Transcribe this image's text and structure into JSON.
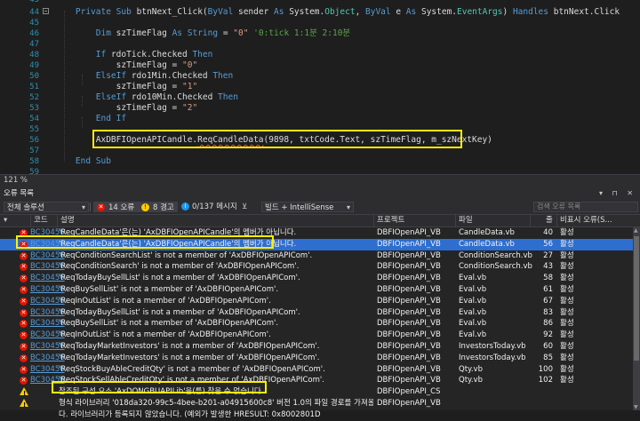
{
  "editor": {
    "line_numbers": [
      "44",
      "45",
      "46",
      "47",
      "48",
      "49",
      "50",
      "51",
      "52",
      "53",
      "54",
      "55",
      "56",
      "57",
      "58",
      "59"
    ],
    "lines": [
      {
        "num": "44",
        "code": "    Private Sub btnNext_Click(ByVal sender As System.Object, ByVal e As System.EventArgs) Handles btnNext.Click"
      },
      {
        "num": "45",
        "code": ""
      },
      {
        "num": "46",
        "code": "        Dim szTimeFlag As String = \"0\" '0:tick 1:1분 2:10분"
      },
      {
        "num": "47",
        "code": ""
      },
      {
        "num": "48",
        "code": "        If rdoTick.Checked Then"
      },
      {
        "num": "49",
        "code": "            szTimeFlag = \"0\""
      },
      {
        "num": "50",
        "code": "        ElseIf rdo1Min.Checked Then"
      },
      {
        "num": "51",
        "code": "            szTimeFlag = \"1\""
      },
      {
        "num": "52",
        "code": "        ElseIf rdo10Min.Checked Then"
      },
      {
        "num": "53",
        "code": "            szTimeFlag = \"2\""
      },
      {
        "num": "54",
        "code": "        End If"
      },
      {
        "num": "55",
        "code": ""
      },
      {
        "num": "56",
        "code": "        AxDBFIOpenAPICandle.ReqCandleData(9898, txtCode.Text, szTimeFlag, m_szNextKey)"
      },
      {
        "num": "57",
        "code": ""
      },
      {
        "num": "58",
        "code": "    End Sub"
      },
      {
        "num": "59",
        "code": ""
      }
    ],
    "zoom": "121 %"
  },
  "error_panel": {
    "title": "오류 목록",
    "scope_dropdown": "전체 솔루션",
    "errors_toggle": "14 오류",
    "warnings_toggle": "8 경고",
    "messages_toggle": "0/137 메시지",
    "build_dropdown": "빌드 + IntelliSense",
    "search_placeholder": "검색 오류 목록",
    "columns": {
      "code": "코드",
      "description": "설명",
      "project": "프로젝트",
      "file": "파일",
      "line": "줄",
      "state": "비표시 오류(S..."
    },
    "rows": [
      {
        "type": "error",
        "code": "BC30456",
        "desc": "'ReqCandleData'은(는) 'AxDBFIOpenAPICandle'의 멤버가 아닙니다.",
        "project": "DBFIOpenAPI_VB",
        "file": "CandleData.vb",
        "line": "40",
        "state": "활성"
      },
      {
        "type": "error",
        "code": "BC30456",
        "desc": "'ReqCandleData'은(는) 'AxDBFIOpenAPICandle'의 멤버가 아닙니다.",
        "project": "DBFIOpenAPI_VB",
        "file": "CandleData.vb",
        "line": "56",
        "state": "활성"
      },
      {
        "type": "error",
        "code": "BC30456",
        "desc": "'ReqConditionSearchList' is not a member of 'AxDBFIOpenAPICom'.",
        "project": "DBFIOpenAPI_VB",
        "file": "ConditionSearch.vb",
        "line": "27",
        "state": "활성"
      },
      {
        "type": "error",
        "code": "BC30456",
        "desc": "'ReqConditionSearch' is not a member of 'AxDBFIOpenAPICom'.",
        "project": "DBFIOpenAPI_VB",
        "file": "ConditionSearch.vb",
        "line": "43",
        "state": "활성"
      },
      {
        "type": "error",
        "code": "BC30456",
        "desc": "'ReqTodayBuySellList' is not a member of 'AxDBFIOpenAPICom'.",
        "project": "DBFIOpenAPI_VB",
        "file": "Eval.vb",
        "line": "58",
        "state": "활성"
      },
      {
        "type": "error",
        "code": "BC30456",
        "desc": "'ReqBuySellList' is not a member of 'AxDBFIOpenAPICom'.",
        "project": "DBFIOpenAPI_VB",
        "file": "Eval.vb",
        "line": "61",
        "state": "활성"
      },
      {
        "type": "error",
        "code": "BC30456",
        "desc": "'ReqInOutList' is not a member of 'AxDBFIOpenAPICom'.",
        "project": "DBFIOpenAPI_VB",
        "file": "Eval.vb",
        "line": "67",
        "state": "활성"
      },
      {
        "type": "error",
        "code": "BC30456",
        "desc": "'ReqTodayBuySellList' is not a member of 'AxDBFIOpenAPICom'.",
        "project": "DBFIOpenAPI_VB",
        "file": "Eval.vb",
        "line": "83",
        "state": "활성"
      },
      {
        "type": "error",
        "code": "BC30456",
        "desc": "'ReqBuySellList' is not a member of 'AxDBFIOpenAPICom'.",
        "project": "DBFIOpenAPI_VB",
        "file": "Eval.vb",
        "line": "86",
        "state": "활성"
      },
      {
        "type": "error",
        "code": "BC30456",
        "desc": "'ReqInOutList' is not a member of 'AxDBFIOpenAPICom'.",
        "project": "DBFIOpenAPI_VB",
        "file": "Eval.vb",
        "line": "92",
        "state": "활성"
      },
      {
        "type": "error",
        "code": "BC30456",
        "desc": "'ReqTodayMarketInvestors' is not a member of 'AxDBFIOpenAPICom'.",
        "project": "DBFIOpenAPI_VB",
        "file": "InvestorsToday.vb",
        "line": "60",
        "state": "활성"
      },
      {
        "type": "error",
        "code": "BC30456",
        "desc": "'ReqTodayMarketInvestors' is not a member of 'AxDBFIOpenAPICom'.",
        "project": "DBFIOpenAPI_VB",
        "file": "InvestorsToday.vb",
        "line": "85",
        "state": "활성"
      },
      {
        "type": "error",
        "code": "BC30456",
        "desc": "'ReqStockBuyAbleCreditQty' is not a member of 'AxDBFIOpenAPICom'.",
        "project": "DBFIOpenAPI_VB",
        "file": "Qty.vb",
        "line": "100",
        "state": "활성"
      },
      {
        "type": "error",
        "code": "BC30456",
        "desc": "'ReqStockSellAbleCreditQty' is not a member of 'AxDBFIOpenAPICom'.",
        "project": "DBFIOpenAPI_VB",
        "file": "Qty.vb",
        "line": "102",
        "state": "활성"
      },
      {
        "type": "warning",
        "code": "",
        "desc": "참조된 구성 요소 'AxDONGBUAPILib'을(를) 찾을 수 없습니다.",
        "project": "DBFIOpenAPI_CS",
        "file": "",
        "line": "",
        "state": ""
      },
      {
        "type": "warning",
        "code": "",
        "desc": "형식 라이브러리 '018da320-99c5-4bee-b201-a04915600c8' 버전 1.0의 파일 경로를 가져올 수 없습니",
        "project": "DBFIOpenAPI_VB",
        "file": "",
        "line": "",
        "state": ""
      },
      {
        "type": "none",
        "code": "",
        "desc": "다. 라이브러리가 등록되지 않았습니다. (예외가 발생한 HRESULT: 0x8002801D",
        "project": "",
        "file": "",
        "line": "",
        "state": ""
      }
    ]
  }
}
